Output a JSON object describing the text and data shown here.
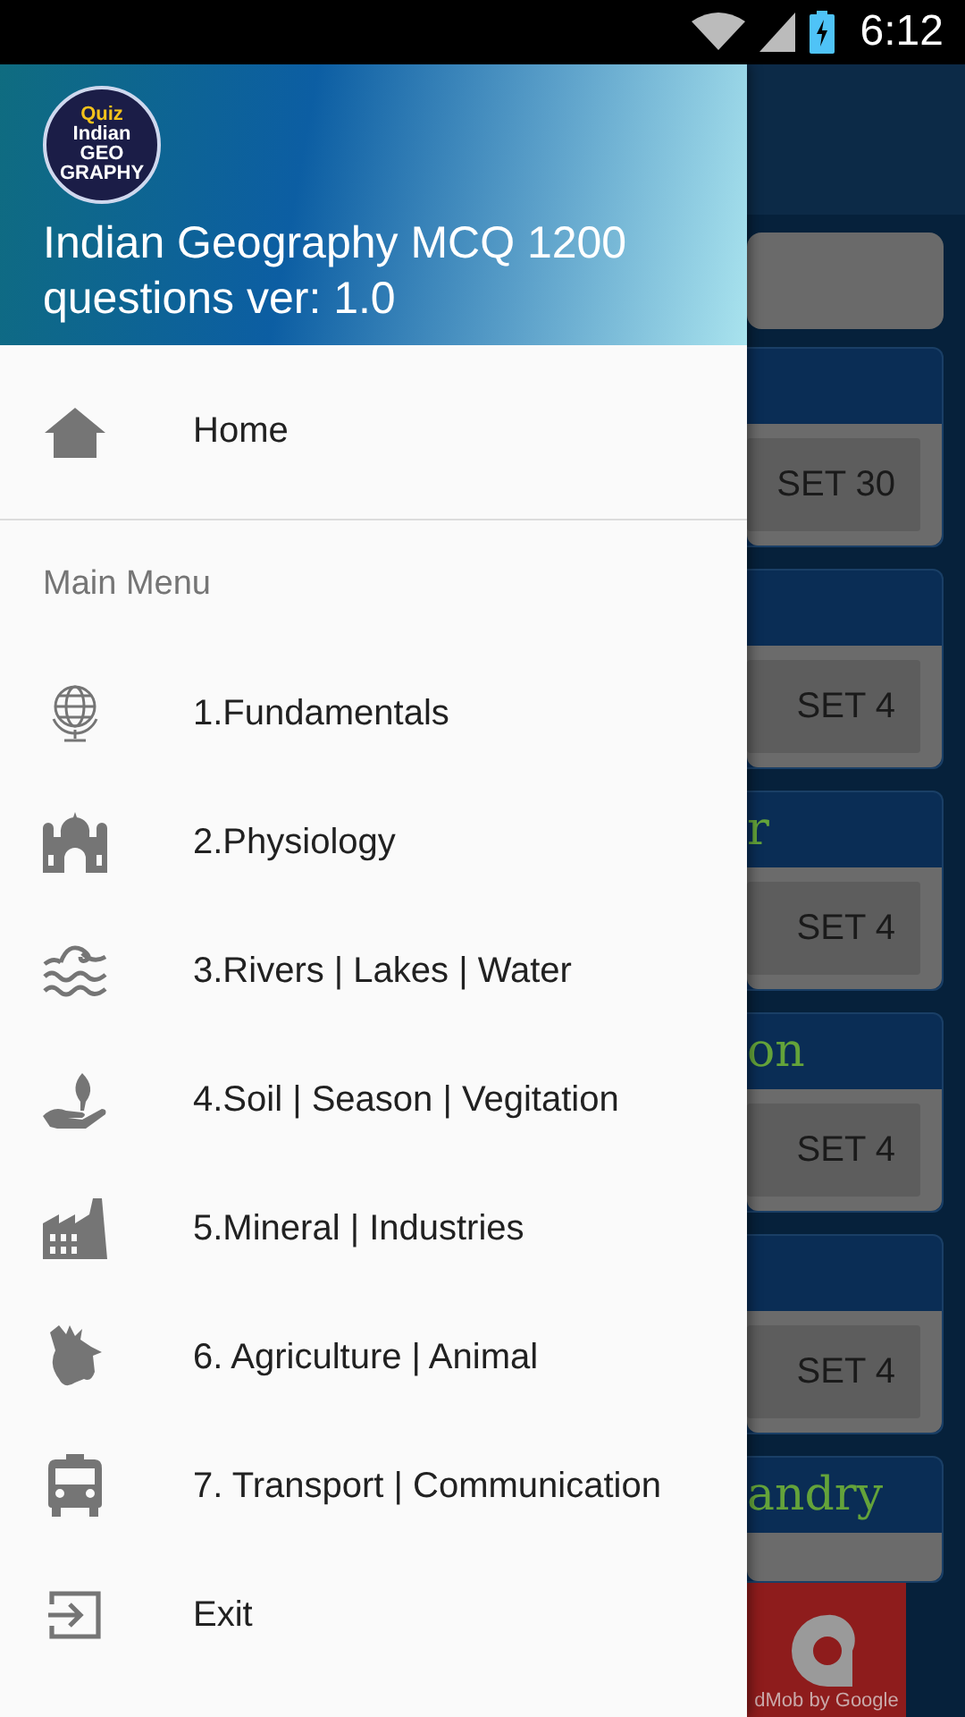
{
  "status_bar": {
    "time": "6:12"
  },
  "drawer": {
    "logo": {
      "lines": [
        "Quiz",
        "Indian",
        "GEO",
        "GRAPHY"
      ]
    },
    "title": "Indian Geography MCQ 1200 questions ver: 1.0",
    "home": {
      "label": "Home"
    },
    "section": "Main Menu",
    "items": [
      {
        "label": "1.Fundamentals"
      },
      {
        "label": "2.Physiology"
      },
      {
        "label": "3.Rivers | Lakes | Water"
      },
      {
        "label": "4.Soil | Season | Vegitation"
      },
      {
        "label": "5.Mineral | Industries"
      },
      {
        "label": "6. Agriculture | Animal"
      },
      {
        "label": "7. Transport | Communication"
      },
      {
        "label": "Exit"
      }
    ]
  },
  "background": {
    "cards": [
      {
        "button": "SET 30"
      },
      {
        "button": "SET 4"
      },
      {
        "title": "r",
        "button": "SET 4"
      },
      {
        "title": "on",
        "button": "SET 4"
      },
      {
        "button": "SET 4"
      },
      {
        "title": "andry"
      }
    ],
    "ad": {
      "text": "dMob by Google"
    }
  }
}
